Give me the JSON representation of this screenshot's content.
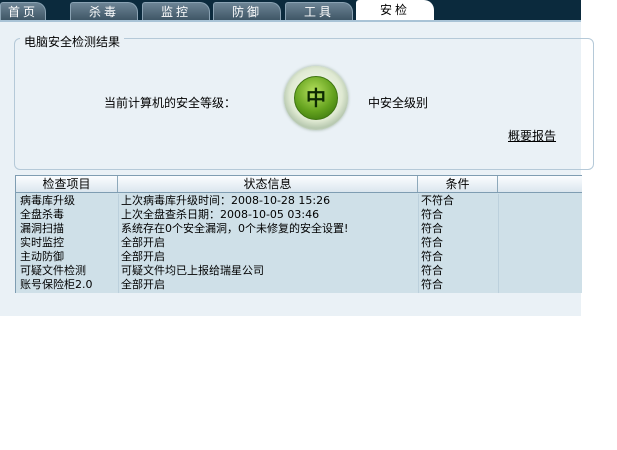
{
  "tabs": [
    {
      "label": "首页"
    },
    {
      "label": "杀毒"
    },
    {
      "label": "监控"
    },
    {
      "label": "防御"
    },
    {
      "label": "工具"
    },
    {
      "label": "安检"
    }
  ],
  "active_tab": "安检",
  "result": {
    "group_title": "电脑安全检测结果",
    "level_label": "当前计算机的安全等级：",
    "level_icon_char": "中",
    "level_text": "中安全级别",
    "report_link": "概要报告"
  },
  "table": {
    "headers": [
      "检查项目",
      "状态信息",
      "条件"
    ],
    "rows": [
      {
        "item": "病毒库升级",
        "status": "上次病毒库升级时间：2008-10-28 15:26",
        "cond": "不符合"
      },
      {
        "item": "全盘杀毒",
        "status": "上次全盘查杀日期：2008-10-05 03:46",
        "cond": "符合"
      },
      {
        "item": "漏洞扫描",
        "status": "系统存在0个安全漏洞，0个未修复的安全设置!",
        "cond": "符合"
      },
      {
        "item": "实时监控",
        "status": "全部开启",
        "cond": "符合"
      },
      {
        "item": "主动防御",
        "status": "全部开启",
        "cond": "符合"
      },
      {
        "item": "可疑文件检测",
        "status": "可疑文件均已上报给瑞星公司",
        "cond": "符合"
      },
      {
        "item": "账号保险柜2.0",
        "status": "全部开启",
        "cond": "符合"
      }
    ]
  },
  "colors": {
    "tabbar_bg": "#0b2a3d",
    "panel_bg": "#eaf1f6",
    "table_bg": "#cfe0e8",
    "level_green": "#64a21e"
  }
}
